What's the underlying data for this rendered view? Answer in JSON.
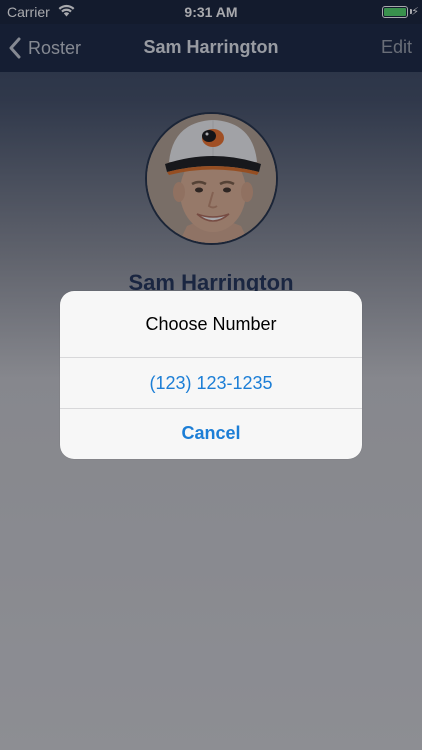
{
  "status_bar": {
    "carrier": "Carrier",
    "time": "9:31 AM",
    "wifi_icon": "wifi-icon",
    "battery_icon": "battery-icon",
    "charging_icon": "bolt-icon"
  },
  "nav": {
    "back_label": "Roster",
    "title": "Sam Harrington",
    "edit_label": "Edit",
    "back_icon": "chevron-left-icon"
  },
  "profile": {
    "name": "Sam Harrington",
    "avatar": "player-avatar"
  },
  "alert": {
    "title": "Choose Number",
    "actions": [
      {
        "label": "(123) 123-1235"
      },
      {
        "label": "Cancel"
      }
    ]
  },
  "colors": {
    "nav_background": "#12203a",
    "accent": "#1c7ed6",
    "name_color": "#1a2c52",
    "battery": "#4cd964"
  }
}
